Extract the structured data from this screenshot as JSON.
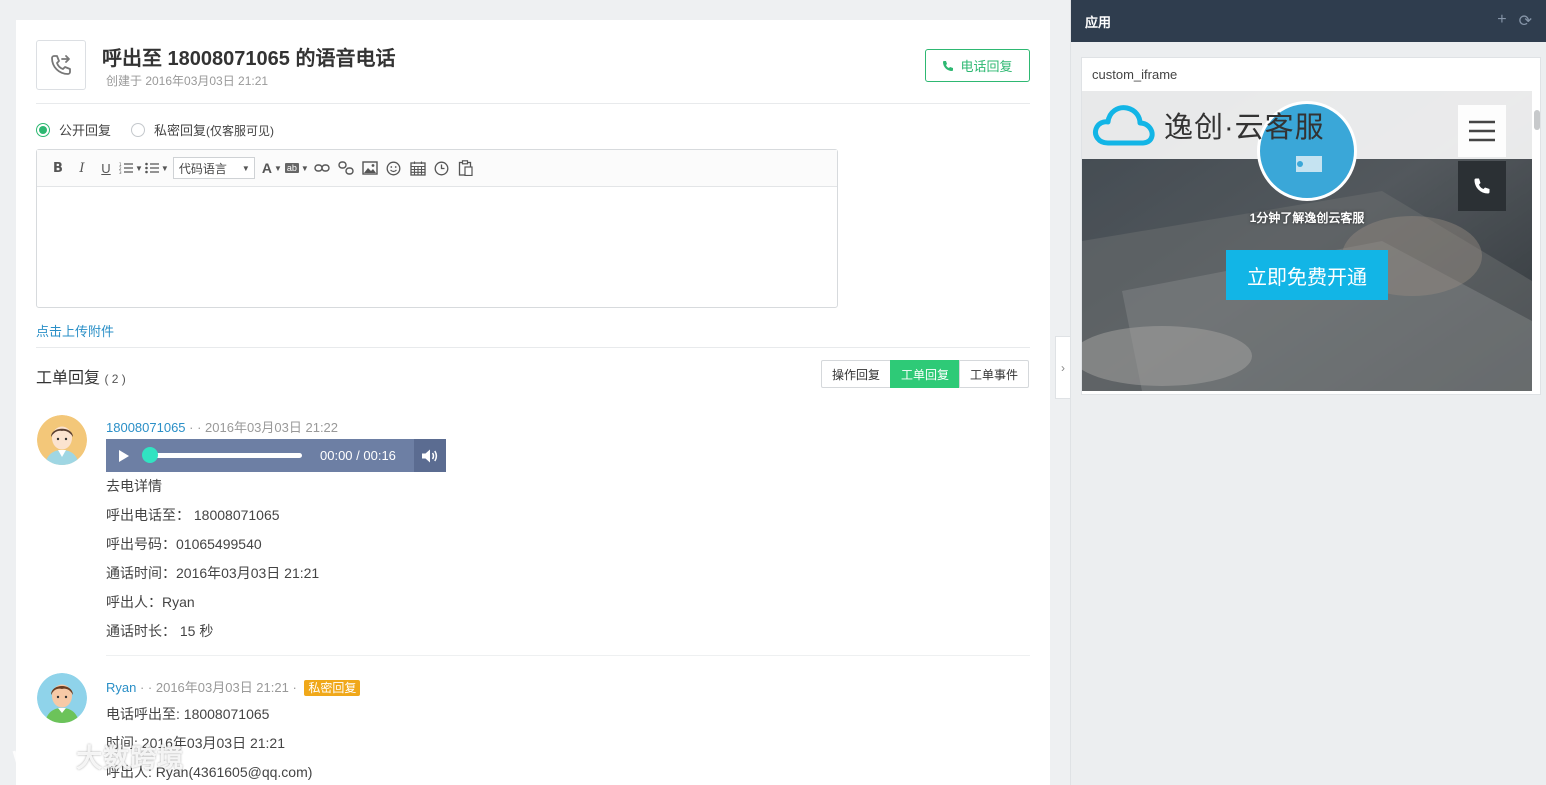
{
  "ticket": {
    "title": "呼出至 18008071065 的语音电话",
    "created": "创建于 2016年03月03日 21:21",
    "phone_reply_label": "电话回复"
  },
  "reply_mode": {
    "public_label": "公开回复",
    "private_label": "私密回复",
    "private_note": "(仅客服可见)",
    "selected": "public"
  },
  "editor": {
    "code_lang_label": "代码语言",
    "toolbar_icons": [
      "bold-icon",
      "italic-icon",
      "underline-icon",
      "ordered-list-icon",
      "unordered-list-icon",
      "font-color-icon",
      "background-color-icon",
      "link-icon",
      "unlink-icon",
      "image-icon",
      "emoji-icon",
      "calendar-icon",
      "clock-icon",
      "paste-icon"
    ]
  },
  "attach_label": "点击上传附件",
  "replies_section": {
    "title": "工单回复",
    "count": "( 2 )",
    "tabs": [
      {
        "label": "操作回复",
        "active": false
      },
      {
        "label": "工单回复",
        "active": true
      },
      {
        "label": "工单事件",
        "active": false
      }
    ]
  },
  "replies": [
    {
      "author": "18008071065",
      "sep": " · · ",
      "time": "2016年03月03日 21:22",
      "audio": {
        "current": "00:00",
        "duration": "00:16",
        "time_text": "00:00 / 00:16",
        "progress": 0
      },
      "lines": [
        "去电详情",
        "呼出电话至： 18008071065",
        "呼出号码：01065499540",
        "通话时间：2016年03月03日 21:21",
        "呼出人：Ryan",
        "通话时长： 15 秒"
      ]
    },
    {
      "author": "Ryan",
      "sep": " · · ",
      "time": "2016年03月03日 21:21",
      "sep2": " · ",
      "badge": "私密回复",
      "lines": [
        "电话呼出至: 18008071065",
        "时间: 2016年03月03日 21:21",
        "呼出人: Ryan(4361605@qq.com)"
      ]
    }
  ],
  "sidebar": {
    "title": "应用",
    "add_icon": "plus-icon",
    "refresh_icon": "refresh-icon",
    "card_title": "custom_iframe",
    "iframe": {
      "brand": "逸创·云客服",
      "video_caption": "1分钟了解逸创云客服",
      "cta": "立即免费开通"
    }
  },
  "watermark": "大数跨境",
  "colors": {
    "accent_green": "#2eb872",
    "tab_active": "#2eca77",
    "link_blue": "#2a8fc7",
    "badge_orange": "#f0a81a",
    "sidebar_header": "#2f3d4e",
    "audio_bg": "#6d7fa4",
    "cta_blue": "#12b5e6"
  }
}
